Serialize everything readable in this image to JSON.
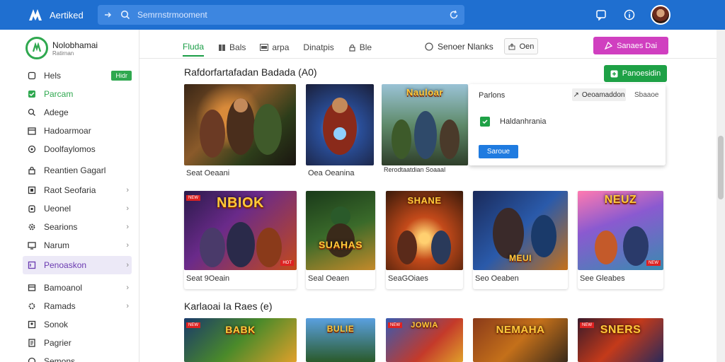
{
  "app": {
    "name": "Aertiked",
    "search_placeholder": "Semrnstrmooment",
    "accent": "#1f6fd0"
  },
  "sidebar": {
    "brand_title": "Nolobhamai",
    "brand_subtitle": "Ratirnan",
    "items": [
      {
        "label": "Hels",
        "icon": "home-icon",
        "badge": "Hidr"
      },
      {
        "label": "Parcam",
        "icon": "check-square-icon"
      },
      {
        "label": "Adege",
        "icon": "search-icon"
      },
      {
        "label": "Hadoarmoar",
        "icon": "calendar-icon"
      },
      {
        "label": "Doolfaylomos",
        "icon": "circle-icon"
      },
      {
        "label": "Reantien Gagarl",
        "icon": "lock-icon"
      },
      {
        "label": "Raot Seofaria",
        "icon": "grid-icon"
      },
      {
        "label": "Ueonel",
        "icon": "lock-icon"
      },
      {
        "label": "Searions",
        "icon": "gear-icon"
      },
      {
        "label": "Narum",
        "icon": "monitor-icon"
      },
      {
        "label": "Penoaskon",
        "icon": "square-icon"
      },
      {
        "label": "Bamoanol",
        "icon": "folder-icon"
      },
      {
        "label": "Ramads",
        "icon": "gear-icon"
      },
      {
        "label": "Sonok",
        "icon": "user-icon"
      },
      {
        "label": "Pagrier",
        "icon": "document-icon"
      },
      {
        "label": "Semons",
        "icon": "chat-icon"
      }
    ]
  },
  "tabs": [
    {
      "label": "Fluda",
      "active": true
    },
    {
      "label": "Bals"
    },
    {
      "label": "arpa"
    },
    {
      "label": "Dinatpis"
    },
    {
      "label": "Ble"
    }
  ],
  "toolbar": {
    "sort_label": "Senoer Nlanks",
    "outline_label": "Oen",
    "pink_label": "Sanaes Dai",
    "green_label": "Panoesidin"
  },
  "section1": {
    "title": "Rafdorfartafadan Badada (A0)",
    "cards": [
      {
        "label": "Seat Oeaani"
      },
      {
        "label": "Oea Oeanina"
      },
      {
        "label": "Rerodtaatdian Soaaal",
        "art_title": "Nauloar"
      }
    ]
  },
  "popup": {
    "title": "Parlons",
    "button_label": "Oeoamaddon",
    "link_label": "Sbaaoe",
    "row_label": "Haldanhrania",
    "blue_label": "Saroue"
  },
  "section1_row2": {
    "cards": [
      {
        "label": "Seat 9Oeain",
        "art_title": "NBIOK"
      },
      {
        "label": "Seal Oeaen",
        "art_title": "SUAHAS"
      },
      {
        "label": "SeaGOiaes",
        "art_title": "SHANE"
      },
      {
        "label": "Seo Oeaben",
        "art_title": "MEUI"
      },
      {
        "label": "See Gleabes",
        "art_title": "NEUZ"
      }
    ]
  },
  "section2": {
    "title": "Karlaoai Ia Raes (e)",
    "cards": [
      {
        "art_title": "BABK"
      },
      {
        "art_title": "BULIE"
      },
      {
        "art_title": "JOWIA"
      },
      {
        "art_title": "NEMAHA"
      },
      {
        "art_title": "SNERS"
      }
    ]
  }
}
